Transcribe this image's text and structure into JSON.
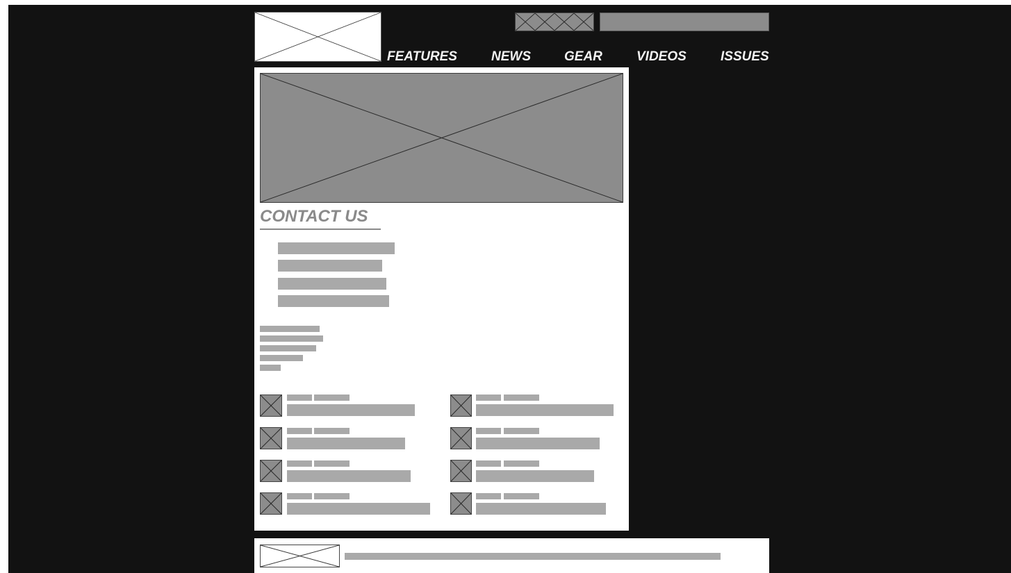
{
  "nav": {
    "items": [
      {
        "label": "FEATURES"
      },
      {
        "label": "NEWS"
      },
      {
        "label": "GEAR"
      },
      {
        "label": "VIDEOS"
      },
      {
        "label": "ISSUES"
      }
    ]
  },
  "main": {
    "title": "CONTACT US"
  },
  "colors": {
    "page_background": "#121212",
    "panel_background": "#ffffff",
    "placeholder_gray": "#8c8c8c",
    "text_bar_gray": "#a9a9a9",
    "nav_text": "#f2f2f2",
    "title_text": "#8a8a8a"
  },
  "icons": [
    "logo-image-placeholder",
    "social-icons-placeholder",
    "hero-image-placeholder",
    "thumbnail-image-placeholder",
    "footer-logo-placeholder"
  ]
}
